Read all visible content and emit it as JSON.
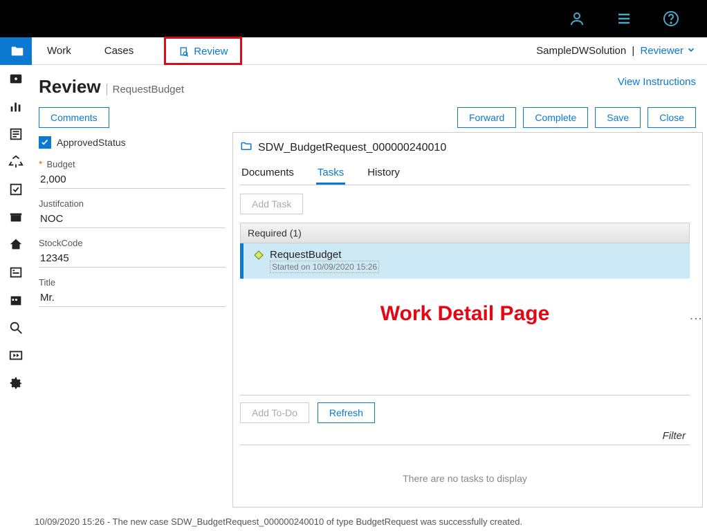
{
  "topTabs": {
    "work": "Work",
    "cases": "Cases",
    "review": "Review"
  },
  "solution": {
    "name": "SampleDWSolution",
    "role": "Reviewer"
  },
  "page": {
    "title": "Review",
    "context": "RequestBudget",
    "viewInstructions": "View Instructions"
  },
  "actions": {
    "comments": "Comments",
    "forward": "Forward",
    "complete": "Complete",
    "save": "Save",
    "close": "Close"
  },
  "form": {
    "approvedStatusLabel": "ApprovedStatus",
    "budgetLabel": "Budget",
    "budgetValue": "2,000",
    "justificationLabel": "Justifcation",
    "justificationValue": "NOC",
    "stockCodeLabel": "StockCode",
    "stockCodeValue": "12345",
    "titleLabel": "Title",
    "titleValue": "Mr."
  },
  "detail": {
    "folderName": "SDW_BudgetRequest_000000240010",
    "subtabs": {
      "documents": "Documents",
      "tasks": "Tasks",
      "history": "History"
    },
    "addTask": "Add Task",
    "requiredHeader": "Required (1)",
    "task": {
      "name": "RequestBudget",
      "started": "Started on 10/09/2020 15:26"
    },
    "annotation": "Work Detail Page",
    "addTodo": "Add To-Do",
    "refresh": "Refresh",
    "filter": "Filter",
    "noTasks": "There are no tasks to display"
  },
  "status": "10/09/2020 15:26 - The new case SDW_BudgetRequest_000000240010 of type BudgetRequest was successfully created."
}
